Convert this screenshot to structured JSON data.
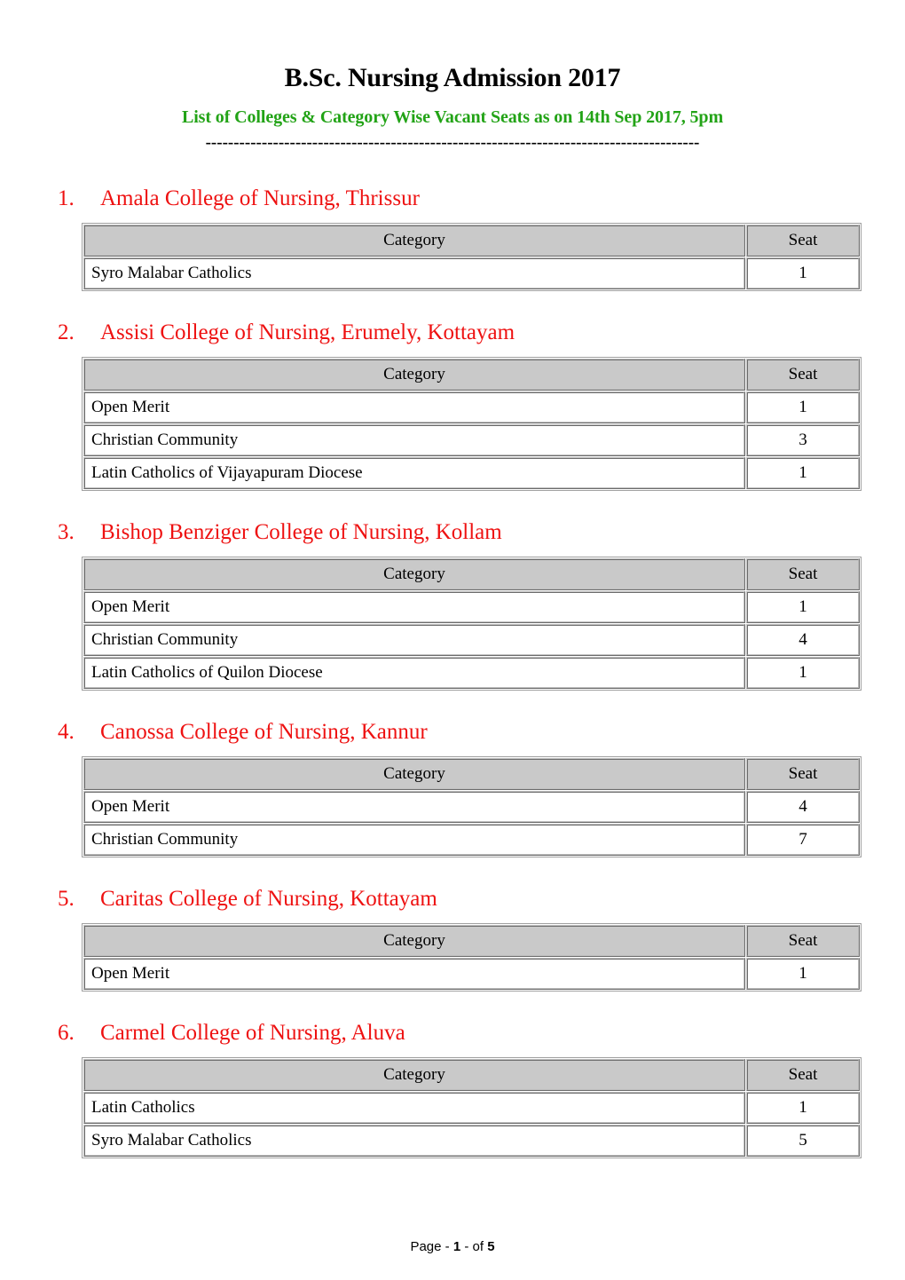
{
  "document": {
    "title": "B.Sc. Nursing Admission 2017",
    "subtitle": "List of Colleges & Category Wise Vacant Seats as on 14th Sep 2017, 5pm",
    "separator": "----------------------------------------------------------------------------------------",
    "title_color": "#000000",
    "subtitle_color": "#22a316",
    "heading_color": "#ee1111"
  },
  "table_headers": {
    "category": "Category",
    "seat": "Seat"
  },
  "colleges": [
    {
      "number": "1.",
      "name": "Amala College of Nursing, Thrissur",
      "rows": [
        {
          "category": "Syro Malabar Catholics",
          "seat": "1"
        }
      ]
    },
    {
      "number": "2.",
      "name": "Assisi College of Nursing, Erumely, Kottayam",
      "rows": [
        {
          "category": "Open Merit",
          "seat": "1"
        },
        {
          "category": "Christian Community",
          "seat": "3"
        },
        {
          "category": "Latin Catholics of Vijayapuram Diocese",
          "seat": "1"
        }
      ]
    },
    {
      "number": "3.",
      "name": "Bishop Benziger College of Nursing, Kollam",
      "rows": [
        {
          "category": "Open Merit",
          "seat": "1"
        },
        {
          "category": "Christian Community",
          "seat": "4"
        },
        {
          "category": "Latin Catholics of Quilon Diocese",
          "seat": "1"
        }
      ]
    },
    {
      "number": "4.",
      "name": "Canossa College of Nursing, Kannur",
      "rows": [
        {
          "category": "Open Merit",
          "seat": "4"
        },
        {
          "category": "Christian Community",
          "seat": "7"
        }
      ]
    },
    {
      "number": "5.",
      "name": "Caritas College of Nursing, Kottayam",
      "rows": [
        {
          "category": "Open Merit",
          "seat": "1"
        }
      ]
    },
    {
      "number": "6.",
      "name": "Carmel College of Nursing, Aluva",
      "rows": [
        {
          "category": "Latin Catholics",
          "seat": "1"
        },
        {
          "category": "Syro Malabar Catholics",
          "seat": "5"
        }
      ]
    }
  ],
  "footer": {
    "prefix": "Page - ",
    "current_page": "1",
    "middle": " - of ",
    "total_pages": "5"
  }
}
